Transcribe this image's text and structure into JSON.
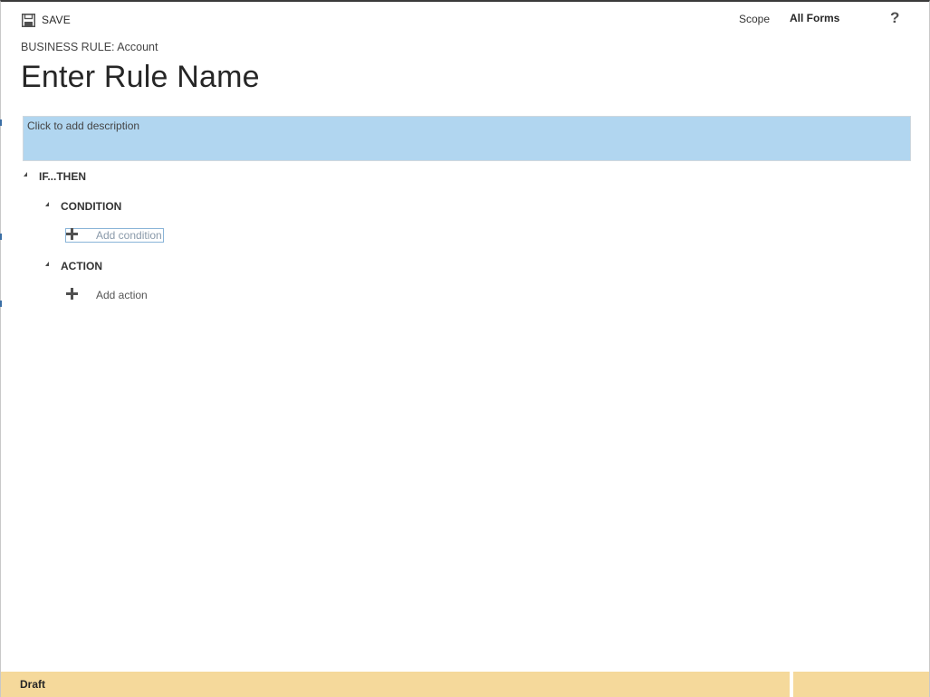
{
  "toolbar": {
    "save_label": "SAVE",
    "save_icon": "floppy-disk-icon",
    "scope_label": "Scope",
    "scope_value": "All Forms",
    "help_icon": "question-mark-icon",
    "help_glyph": "?"
  },
  "header": {
    "entity_label": "BUSINESS RULE: Account",
    "rule_name": "Enter Rule Name"
  },
  "description": {
    "placeholder": "Click to add description",
    "background_color": "#b1d6f0"
  },
  "tree": {
    "root_label": "IF...THEN",
    "condition": {
      "label": "CONDITION",
      "add_label": "Add condition"
    },
    "action": {
      "label": "ACTION",
      "add_label": "Add action"
    },
    "expand_icon": "expanded-triangle-icon",
    "add_icon": "plus-icon"
  },
  "status": {
    "text": "Draft",
    "background_color": "#f5d99b"
  }
}
